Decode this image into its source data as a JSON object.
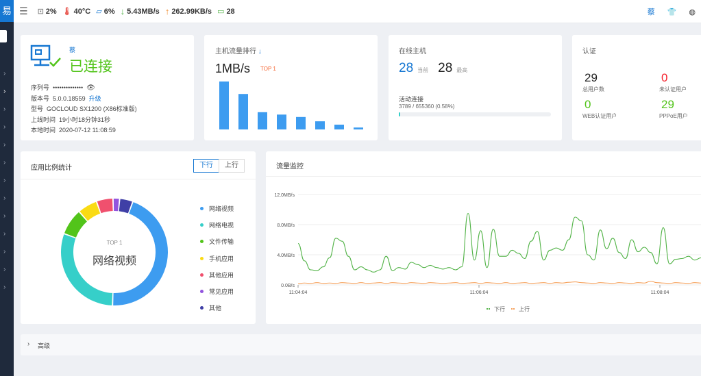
{
  "sidebar": {
    "logo_char": "易"
  },
  "topbar": {
    "cpu": "2%",
    "temp": "40°C",
    "mem": "6%",
    "down": "5.43MB/s",
    "up": "262.99KB/s",
    "hosts": "28",
    "right_label": "蔡"
  },
  "status": {
    "user": "蔡",
    "connected": "已连接",
    "serial_label": "序列号",
    "serial_value": "••••••••••••••",
    "version_label": "版本号",
    "version_value": "5.0.0.18559",
    "upgrade": "升级",
    "model_label": "型号",
    "model_value": "GOCLOUD SX1200 (X86标准版)",
    "uptime_label": "上线时间",
    "uptime_value": "19小时18分钟31秒",
    "localtime_label": "本地时间",
    "localtime_value": "2020-07-12 11:08:59"
  },
  "host_traffic": {
    "title": "主机流量排行",
    "value": "1MB/s",
    "badge": "TOP 1",
    "bars": [
      1.0,
      0.74,
      0.36,
      0.31,
      0.26,
      0.17,
      0.1,
      0.04
    ],
    "bar_color": "#3d9cf0"
  },
  "online": {
    "title": "在线主机",
    "current": "28",
    "current_label": "当前",
    "max": "28",
    "max_label": "最高",
    "active_title": "活动连接",
    "active_value": "3789 / 655360 (0.58%)",
    "active_pct": 0.58
  },
  "auth": {
    "title": "认证",
    "total": "29",
    "total_label": "总用户数",
    "unauth": "0",
    "unauth_label": "未认证用户",
    "web": "0",
    "web_label": "WEB认证用户",
    "pppoe": "29",
    "pppoe_label": "PPPoE用户"
  },
  "app_ratio": {
    "title": "应用比例统计",
    "btn_down": "下行",
    "btn_up": "上行",
    "center_top": "TOP 1",
    "center_name": "网络视频",
    "slices": [
      {
        "name": "网络视频",
        "color": "#3d9cf0",
        "value": 45
      },
      {
        "name": "网络电视",
        "color": "#36cfc9",
        "value": 30
      },
      {
        "name": "文件传输",
        "color": "#52c41a",
        "value": 8
      },
      {
        "name": "手机应用",
        "color": "#fadb14",
        "value": 6
      },
      {
        "name": "其他应用",
        "color": "#f0506e",
        "value": 5
      },
      {
        "name": "常见应用",
        "color": "#9254de",
        "value": 2
      },
      {
        "name": "其他",
        "color": "#3f3fa6",
        "value": 4
      }
    ]
  },
  "traffic_monitor": {
    "title": "流量监控"
  },
  "chart_data": {
    "type": "line",
    "yticks": [
      "12.0MB/s",
      "8.0MB/s",
      "4.0MB/s",
      "0.0B/s"
    ],
    "ylim": [
      0,
      12
    ],
    "xticks": [
      "11:04:04",
      "11:06:04",
      "11:08:04"
    ],
    "series": [
      {
        "name": "下行",
        "color": "#52b347",
        "values": [
          5.5,
          3.2,
          2.0,
          1.9,
          2.4,
          3.6,
          6.2,
          5.8,
          3.8,
          2.0,
          2.4,
          2.0,
          1.7,
          2.0,
          3.8,
          1.9,
          2.3,
          2.1,
          3.0,
          2.7,
          2.3,
          2.6,
          2.3,
          2.1,
          2.3,
          2.0,
          2.4,
          9.5,
          3.3,
          7.2,
          2.3,
          7.4,
          3.8,
          3.8,
          4.6,
          4.2,
          3.5,
          5.8,
          7.1,
          3.3,
          4.6,
          4.9,
          4.6,
          6.0,
          9.0,
          8.5,
          4.0,
          3.3,
          7.3,
          4.8,
          6.2,
          4.3,
          3.5,
          6.0,
          4.4,
          5.0,
          4.3,
          2.8,
          7.6,
          2.8,
          3.4,
          3.5,
          3.8,
          3.3,
          3.6
        ]
      },
      {
        "name": "上行",
        "color": "#f5a05a",
        "values": [
          0.15,
          0.25,
          0.2,
          0.3,
          0.2,
          0.25,
          0.2,
          0.3,
          0.25,
          0.2,
          0.3,
          0.2,
          0.25,
          0.3,
          0.2,
          0.3,
          0.25,
          0.2,
          0.3,
          0.25,
          0.2,
          0.3,
          0.25,
          0.2,
          0.25,
          0.3,
          0.2,
          0.25,
          0.3,
          0.2,
          0.3,
          0.25,
          0.2,
          0.3,
          0.2,
          0.25,
          0.3,
          0.2,
          0.25,
          0.3,
          0.2,
          0.3,
          0.25,
          0.35,
          0.4,
          0.3,
          0.25,
          0.2,
          0.3,
          0.25,
          0.2,
          0.3,
          0.25,
          0.2,
          0.3,
          0.25,
          0.5,
          0.3,
          0.25,
          0.2,
          0.3,
          0.25,
          0.2,
          0.3,
          0.25
        ]
      }
    ]
  },
  "advanced": {
    "label": "高级"
  }
}
